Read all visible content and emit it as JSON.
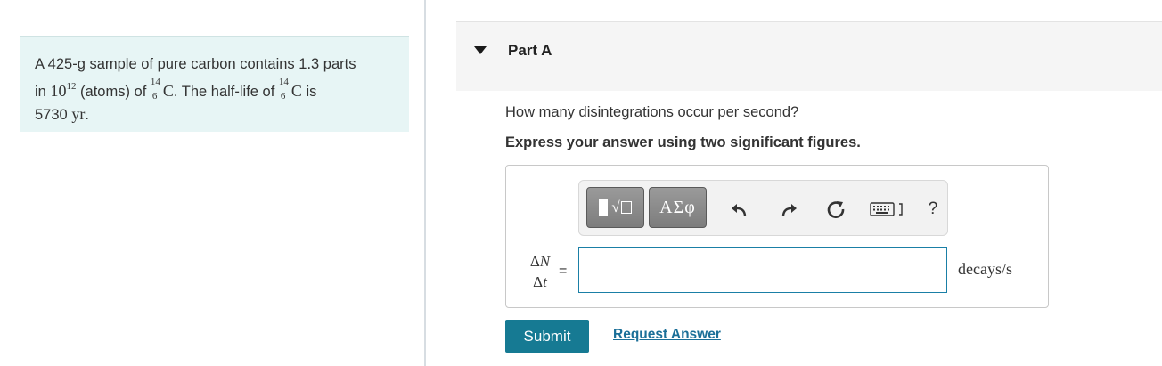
{
  "problem": {
    "text_1": "A 425-g sample of pure carbon contains 1.3 parts",
    "text_2a": "in ",
    "power_base": "10",
    "power_exp": "12",
    "text_2b": " (atoms) of ",
    "isotope_mass": "14",
    "isotope_atomic": "6",
    "isotope_symbol": "C",
    "text_2c": ". The half-life of ",
    "text_2d": " is",
    "halflife_value": "5730",
    "halflife_unit": "yr",
    "text_3_end": "."
  },
  "part": {
    "title": "Part A"
  },
  "question": "How many disintegrations occur per second?",
  "instruction": "Express your answer using two significant figures.",
  "toolbar": {
    "greek_label": "ΑΣφ",
    "sqrt_label": "√",
    "undo_icon": "undo-icon",
    "redo_icon": "redo-icon",
    "reset_icon": "reset-icon",
    "keyboard_icon": "keyboard-icon",
    "help_label": "?"
  },
  "equation": {
    "numerator_delta": "Δ",
    "numerator_var": "N",
    "denominator_delta": "Δ",
    "denominator_var": "t",
    "equals": "=",
    "answer_value": "",
    "units": "decays/s"
  },
  "actions": {
    "submit_label": "Submit",
    "request_label": "Request Answer"
  },
  "colors": {
    "problem_bg": "#e7f5f5",
    "submit_bg": "#167a93",
    "link": "#1b6f98",
    "input_border": "#1a7fa6"
  }
}
